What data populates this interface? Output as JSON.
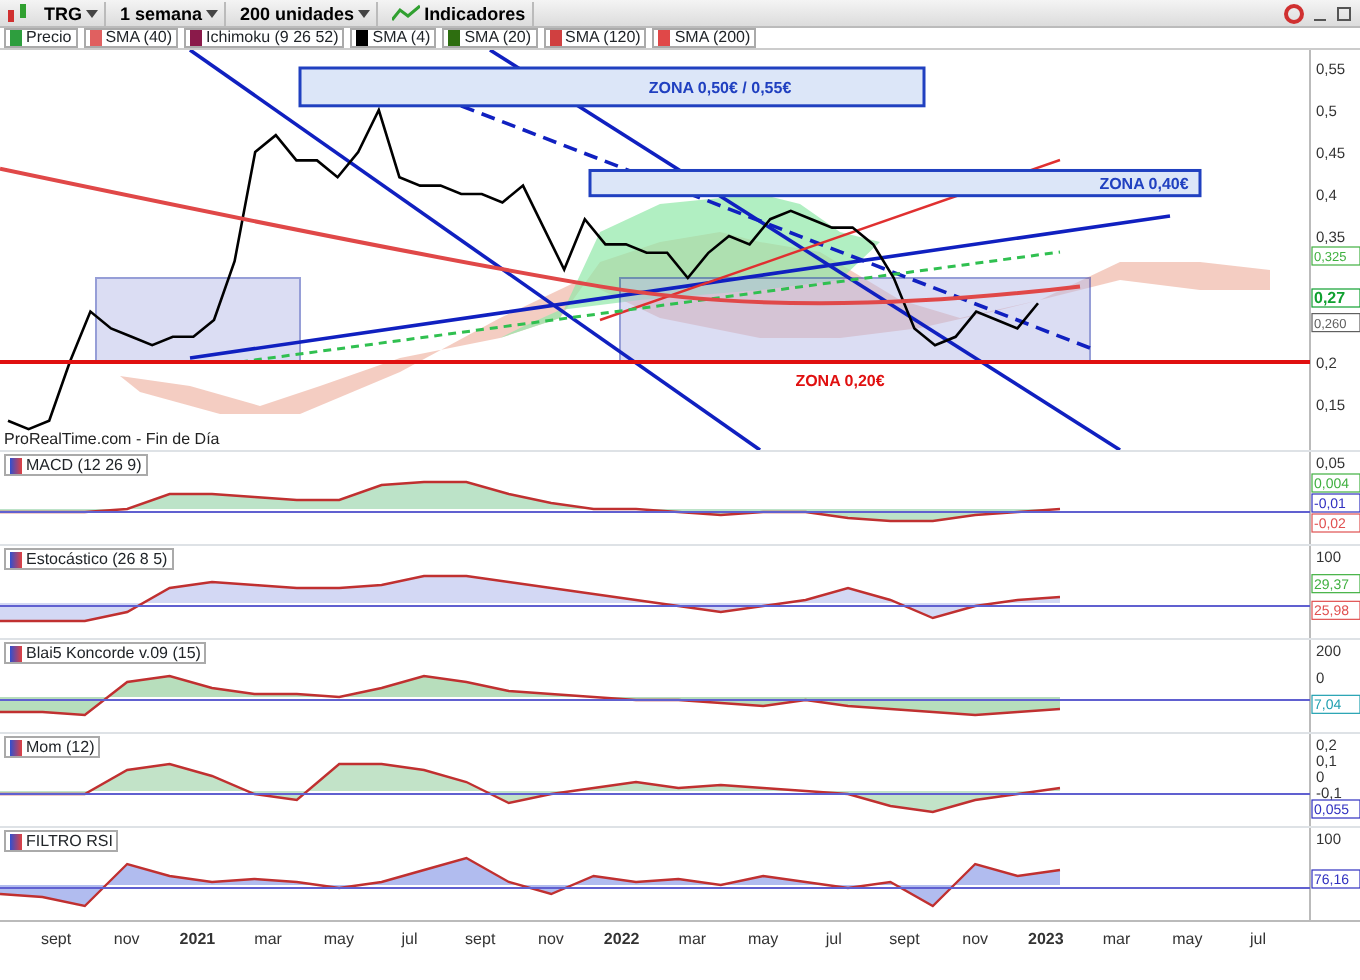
{
  "toolbar": {
    "symbol": "TRG",
    "period": "1 semana",
    "units": "200 unidades",
    "indicators_button": "Indicadores"
  },
  "legend": [
    {
      "label": "Precio",
      "color": "#2e9e3e"
    },
    {
      "label": "SMA (40)",
      "color": "#e06060"
    },
    {
      "label": "Ichimoku (9 26 52)",
      "color": "#8a1a4a"
    },
    {
      "label": "SMA (4)",
      "color": "#000000"
    },
    {
      "label": "SMA (20)",
      "color": "#2e6e10"
    },
    {
      "label": "SMA (120)",
      "color": "#d04040"
    },
    {
      "label": "SMA (200)",
      "color": "#e04848"
    }
  ],
  "price_chart": {
    "source_label": "ProRealTime.com - Fin de Día",
    "zones": [
      {
        "text": "ZONA 0,50€ / 0,55€",
        "color": "#2040c0"
      },
      {
        "text": "ZONA 0,40€",
        "color": "#2040c0"
      },
      {
        "text": "ZONA 0,20€",
        "color": "#e01010"
      }
    ],
    "axis_labels": [
      "0,55",
      "0,5",
      "0,45",
      "0,4",
      "0,35",
      "0,2",
      "0,15"
    ],
    "readings": [
      {
        "text": "0,325",
        "color": "#40b040"
      },
      {
        "text": "0,27",
        "color": "#10a030"
      },
      {
        "text": "0,260",
        "color": "#606060"
      }
    ]
  },
  "indicators": [
    {
      "kind": "macd",
      "label": "MACD (12 26 9)",
      "ticks": [
        "0,05"
      ],
      "readings": [
        {
          "text": "0,004",
          "color": "#40b040"
        },
        {
          "text": "-0,01",
          "color": "#3030c0"
        },
        {
          "text": "-0,02",
          "color": "#e05050"
        }
      ]
    },
    {
      "kind": "stochastic",
      "label": "Estocástico (26 8 5)",
      "ticks": [
        "100"
      ],
      "readings": [
        {
          "text": "29,37",
          "color": "#40b040"
        },
        {
          "text": "25,98",
          "color": "#e05050"
        }
      ]
    },
    {
      "kind": "koncorde",
      "label": "Blai5 Koncorde v.09 (15)",
      "ticks": [
        "200",
        "0"
      ],
      "readings": [
        {
          "text": "7,04",
          "color": "#20a0b0"
        }
      ]
    },
    {
      "kind": "momentum",
      "label": "Mom (12)",
      "ticks": [
        "0,2",
        "0,1",
        "0",
        "-0,1"
      ],
      "readings": [
        {
          "text": "0,055",
          "color": "#3030c0"
        }
      ]
    },
    {
      "kind": "rsi",
      "label": "FILTRO RSI",
      "ticks": [
        "100"
      ],
      "readings": [
        {
          "text": "76,16",
          "color": "#3030c0"
        }
      ]
    }
  ],
  "time_axis": [
    "sept",
    "nov",
    "2021",
    "mar",
    "may",
    "jul",
    "sept",
    "nov",
    "2022",
    "mar",
    "may",
    "jul",
    "sept",
    "nov",
    "2023",
    "mar",
    "may",
    "jul"
  ]
}
